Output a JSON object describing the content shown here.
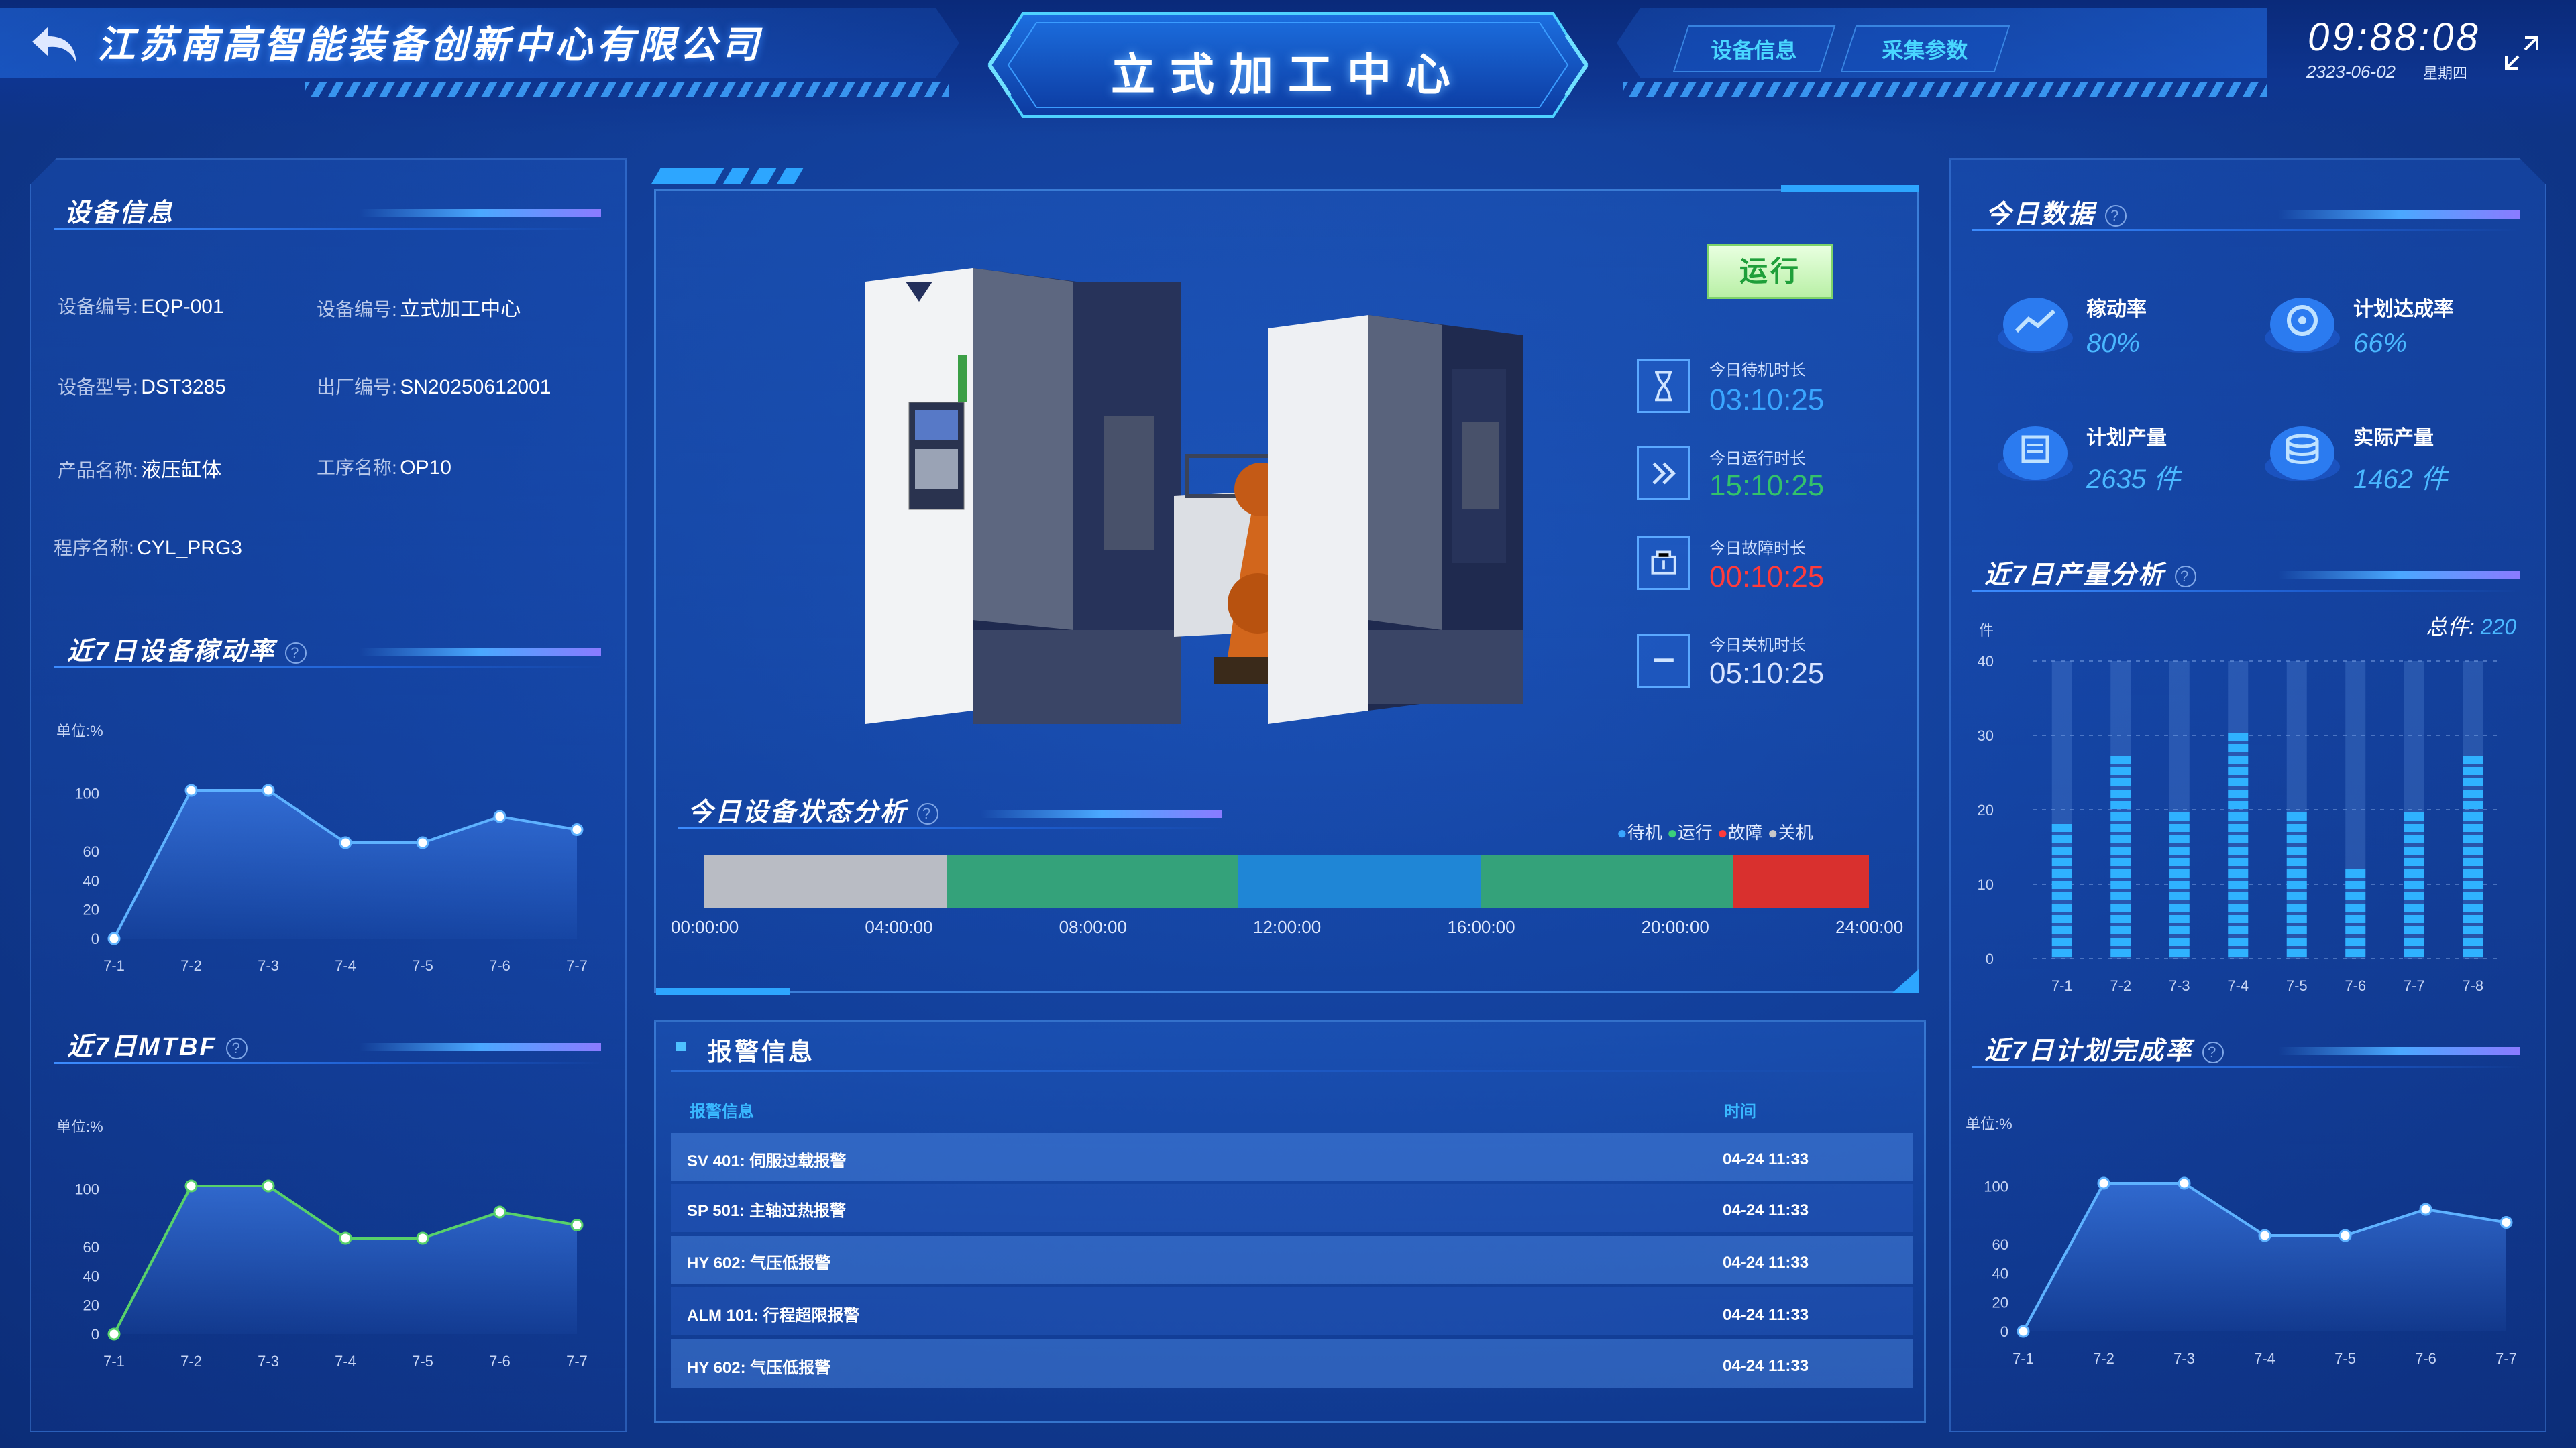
{
  "header": {
    "company": "江苏南高智能装备创新中心有限公司",
    "title": "立式加工中心",
    "tabs": [
      "设备信息",
      "采集参数"
    ],
    "clock": "09:88:08",
    "date": "2323-06-02",
    "weekday": "星期四"
  },
  "device_info": {
    "title": "设备信息",
    "fields": [
      {
        "label": "设备编号:",
        "value": "EQP-001"
      },
      {
        "label": "设备编号:",
        "value": "立式加工中心"
      },
      {
        "label": "设备型号:",
        "value": "DST3285"
      },
      {
        "label": "出厂编号:",
        "value": "SN20250612001"
      },
      {
        "label": "产品名称:",
        "value": "液压缸体"
      },
      {
        "label": "工序名称:",
        "value": "OP10"
      },
      {
        "label": "程序名称:",
        "value": "CYL_PRG3"
      }
    ]
  },
  "status_badge": "运行",
  "today_stats": [
    {
      "label": "今日待机时长",
      "value": "03:10:25",
      "color": "#3aa6ff",
      "icon": "hourglass-icon"
    },
    {
      "label": "今日运行时长",
      "value": "15:10:25",
      "color": "#33c26b",
      "icon": "fast-forward-icon"
    },
    {
      "label": "今日故障时长",
      "value": "00:10:25",
      "color": "#ff3b3b",
      "icon": "fault-icon"
    },
    {
      "label": "今日关机时长",
      "value": "05:10:25",
      "color": "#d8e4ff",
      "icon": "power-off-icon"
    }
  ],
  "status_analysis": {
    "title": "今日设备状态分析",
    "legend": [
      {
        "name": "待机",
        "color": "#3aa6ff"
      },
      {
        "name": "运行",
        "color": "#3bcf7a"
      },
      {
        "name": "故障",
        "color": "#ff3b3b"
      },
      {
        "name": "关机",
        "color": "#c8c8c8"
      }
    ],
    "segments": [
      {
        "state": "关机",
        "from": 0,
        "to": 5,
        "color": "#b9bcc4"
      },
      {
        "state": "运行",
        "from": 5,
        "to": 11,
        "color": "#34a27a"
      },
      {
        "state": "待机",
        "from": 11,
        "to": 16,
        "color": "#1f86d6"
      },
      {
        "state": "运行",
        "from": 16,
        "to": 21.2,
        "color": "#34a27a"
      },
      {
        "state": "故障",
        "from": 21.2,
        "to": 24,
        "color": "#d9302e"
      }
    ],
    "ticks": [
      "00:00:00",
      "04:00:00",
      "08:00:00",
      "12:00:00",
      "16:00:00",
      "20:00:00",
      "24:00:00"
    ]
  },
  "alarms": {
    "title": "报警信息",
    "col_msg": "报警信息",
    "col_time": "时间",
    "rows": [
      {
        "msg": "SV 401: 伺服过载报警",
        "time": "04-24 11:33"
      },
      {
        "msg": "SP 501: 主轴过热报警",
        "time": "04-24 11:33"
      },
      {
        "msg": "HY 602: 气压低报警",
        "time": "04-24 11:33"
      },
      {
        "msg": "ALM 101: 行程超限报警",
        "time": "04-24 11:33"
      },
      {
        "msg": "HY 602: 气压低报警",
        "time": "04-24 11:33"
      }
    ]
  },
  "today_data": {
    "title": "今日数据",
    "kpis": [
      {
        "label": "稼动率",
        "value": "80%",
        "icon": "utilization-icon"
      },
      {
        "label": "计划达成率",
        "value": "66%",
        "icon": "target-icon"
      },
      {
        "label": "计划产量",
        "value": "2635 件",
        "icon": "plan-icon"
      },
      {
        "label": "实际产量",
        "value": "1462 件",
        "icon": "stack-icon"
      }
    ]
  },
  "chart_data": [
    {
      "id": "utilization",
      "type": "line",
      "title": "近7日设备稼动率",
      "unit": "单位:%",
      "categories": [
        "7-1",
        "7-2",
        "7-3",
        "7-4",
        "7-5",
        "7-6",
        "7-7"
      ],
      "values": [
        0,
        102,
        102,
        66,
        66,
        84,
        75
      ],
      "yticks": [
        0,
        20,
        40,
        60,
        100
      ],
      "color": "#5eb2ff"
    },
    {
      "id": "mtbf",
      "type": "line",
      "title": "近7日MTBF",
      "unit": "单位:%",
      "categories": [
        "7-1",
        "7-2",
        "7-3",
        "7-4",
        "7-5",
        "7-6",
        "7-7"
      ],
      "values": [
        0,
        102,
        102,
        66,
        66,
        84,
        75
      ],
      "yticks": [
        0,
        20,
        40,
        60,
        100
      ],
      "color": "#57d16a"
    },
    {
      "id": "output",
      "type": "bar",
      "title": "近7日产量分析",
      "unit": "件",
      "total_label": "总件:",
      "total_value": "220",
      "categories": [
        "7-1",
        "7-2",
        "7-3",
        "7-4",
        "7-5",
        "7-6",
        "7-7",
        "7-8"
      ],
      "values": [
        19,
        28,
        21,
        31,
        21,
        13,
        21,
        28
      ],
      "ylim": [
        0,
        40
      ],
      "yticks": [
        0,
        10,
        20,
        30,
        40
      ],
      "color": "#2fb2ff"
    },
    {
      "id": "plan",
      "type": "line",
      "title": "近7日计划完成率",
      "unit": "单位:%",
      "categories": [
        "7-1",
        "7-2",
        "7-3",
        "7-4",
        "7-5",
        "7-6",
        "7-7"
      ],
      "values": [
        0,
        102,
        102,
        66,
        66,
        84,
        75
      ],
      "yticks": [
        0,
        20,
        40,
        60,
        100
      ],
      "color": "#5eb2ff"
    }
  ]
}
